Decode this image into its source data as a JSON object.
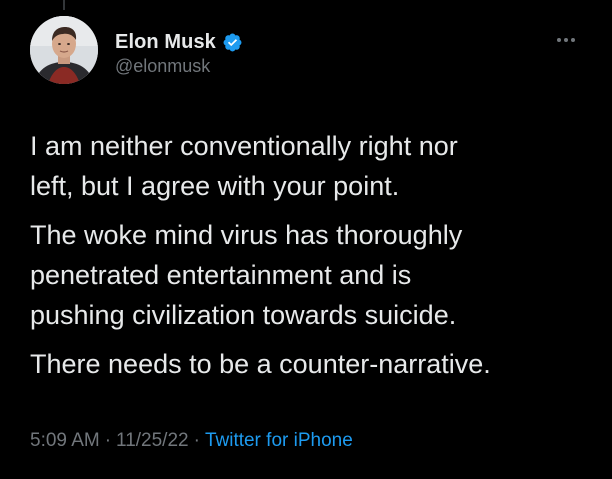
{
  "colors": {
    "background": "#000000",
    "primary_text": "#e7e9ea",
    "secondary_text": "#71767b",
    "accent": "#1d9bf0"
  },
  "author": {
    "display_name": "Elon Musk",
    "handle": "@elonmusk",
    "verified_icon": "verified-badge-icon",
    "avatar_icon": "avatar"
  },
  "more_icon": "more-options-icon",
  "tweet": {
    "paragraphs": [
      "I am neither conventionally right nor\nleft, but I agree with your point.",
      "The woke mind virus has thoroughly\npenetrated entertainment and is\npushing civilization towards suicide.",
      "There needs to be a counter-narrative."
    ]
  },
  "meta": {
    "time": "5:09 AM",
    "separator": "·",
    "date": "11/25/22",
    "source": "Twitter for iPhone"
  }
}
